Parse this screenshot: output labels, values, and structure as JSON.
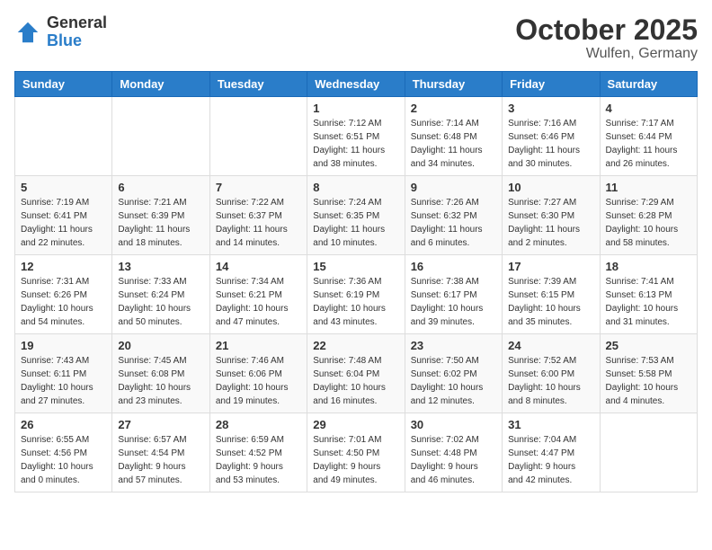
{
  "header": {
    "logo_general": "General",
    "logo_blue": "Blue",
    "month_title": "October 2025",
    "location": "Wulfen, Germany"
  },
  "weekdays": [
    "Sunday",
    "Monday",
    "Tuesday",
    "Wednesday",
    "Thursday",
    "Friday",
    "Saturday"
  ],
  "weeks": [
    [
      {
        "day": "",
        "info": ""
      },
      {
        "day": "",
        "info": ""
      },
      {
        "day": "",
        "info": ""
      },
      {
        "day": "1",
        "info": "Sunrise: 7:12 AM\nSunset: 6:51 PM\nDaylight: 11 hours\nand 38 minutes."
      },
      {
        "day": "2",
        "info": "Sunrise: 7:14 AM\nSunset: 6:48 PM\nDaylight: 11 hours\nand 34 minutes."
      },
      {
        "day": "3",
        "info": "Sunrise: 7:16 AM\nSunset: 6:46 PM\nDaylight: 11 hours\nand 30 minutes."
      },
      {
        "day": "4",
        "info": "Sunrise: 7:17 AM\nSunset: 6:44 PM\nDaylight: 11 hours\nand 26 minutes."
      }
    ],
    [
      {
        "day": "5",
        "info": "Sunrise: 7:19 AM\nSunset: 6:41 PM\nDaylight: 11 hours\nand 22 minutes."
      },
      {
        "day": "6",
        "info": "Sunrise: 7:21 AM\nSunset: 6:39 PM\nDaylight: 11 hours\nand 18 minutes."
      },
      {
        "day": "7",
        "info": "Sunrise: 7:22 AM\nSunset: 6:37 PM\nDaylight: 11 hours\nand 14 minutes."
      },
      {
        "day": "8",
        "info": "Sunrise: 7:24 AM\nSunset: 6:35 PM\nDaylight: 11 hours\nand 10 minutes."
      },
      {
        "day": "9",
        "info": "Sunrise: 7:26 AM\nSunset: 6:32 PM\nDaylight: 11 hours\nand 6 minutes."
      },
      {
        "day": "10",
        "info": "Sunrise: 7:27 AM\nSunset: 6:30 PM\nDaylight: 11 hours\nand 2 minutes."
      },
      {
        "day": "11",
        "info": "Sunrise: 7:29 AM\nSunset: 6:28 PM\nDaylight: 10 hours\nand 58 minutes."
      }
    ],
    [
      {
        "day": "12",
        "info": "Sunrise: 7:31 AM\nSunset: 6:26 PM\nDaylight: 10 hours\nand 54 minutes."
      },
      {
        "day": "13",
        "info": "Sunrise: 7:33 AM\nSunset: 6:24 PM\nDaylight: 10 hours\nand 50 minutes."
      },
      {
        "day": "14",
        "info": "Sunrise: 7:34 AM\nSunset: 6:21 PM\nDaylight: 10 hours\nand 47 minutes."
      },
      {
        "day": "15",
        "info": "Sunrise: 7:36 AM\nSunset: 6:19 PM\nDaylight: 10 hours\nand 43 minutes."
      },
      {
        "day": "16",
        "info": "Sunrise: 7:38 AM\nSunset: 6:17 PM\nDaylight: 10 hours\nand 39 minutes."
      },
      {
        "day": "17",
        "info": "Sunrise: 7:39 AM\nSunset: 6:15 PM\nDaylight: 10 hours\nand 35 minutes."
      },
      {
        "day": "18",
        "info": "Sunrise: 7:41 AM\nSunset: 6:13 PM\nDaylight: 10 hours\nand 31 minutes."
      }
    ],
    [
      {
        "day": "19",
        "info": "Sunrise: 7:43 AM\nSunset: 6:11 PM\nDaylight: 10 hours\nand 27 minutes."
      },
      {
        "day": "20",
        "info": "Sunrise: 7:45 AM\nSunset: 6:08 PM\nDaylight: 10 hours\nand 23 minutes."
      },
      {
        "day": "21",
        "info": "Sunrise: 7:46 AM\nSunset: 6:06 PM\nDaylight: 10 hours\nand 19 minutes."
      },
      {
        "day": "22",
        "info": "Sunrise: 7:48 AM\nSunset: 6:04 PM\nDaylight: 10 hours\nand 16 minutes."
      },
      {
        "day": "23",
        "info": "Sunrise: 7:50 AM\nSunset: 6:02 PM\nDaylight: 10 hours\nand 12 minutes."
      },
      {
        "day": "24",
        "info": "Sunrise: 7:52 AM\nSunset: 6:00 PM\nDaylight: 10 hours\nand 8 minutes."
      },
      {
        "day": "25",
        "info": "Sunrise: 7:53 AM\nSunset: 5:58 PM\nDaylight: 10 hours\nand 4 minutes."
      }
    ],
    [
      {
        "day": "26",
        "info": "Sunrise: 6:55 AM\nSunset: 4:56 PM\nDaylight: 10 hours\nand 0 minutes."
      },
      {
        "day": "27",
        "info": "Sunrise: 6:57 AM\nSunset: 4:54 PM\nDaylight: 9 hours\nand 57 minutes."
      },
      {
        "day": "28",
        "info": "Sunrise: 6:59 AM\nSunset: 4:52 PM\nDaylight: 9 hours\nand 53 minutes."
      },
      {
        "day": "29",
        "info": "Sunrise: 7:01 AM\nSunset: 4:50 PM\nDaylight: 9 hours\nand 49 minutes."
      },
      {
        "day": "30",
        "info": "Sunrise: 7:02 AM\nSunset: 4:48 PM\nDaylight: 9 hours\nand 46 minutes."
      },
      {
        "day": "31",
        "info": "Sunrise: 7:04 AM\nSunset: 4:47 PM\nDaylight: 9 hours\nand 42 minutes."
      },
      {
        "day": "",
        "info": ""
      }
    ]
  ]
}
